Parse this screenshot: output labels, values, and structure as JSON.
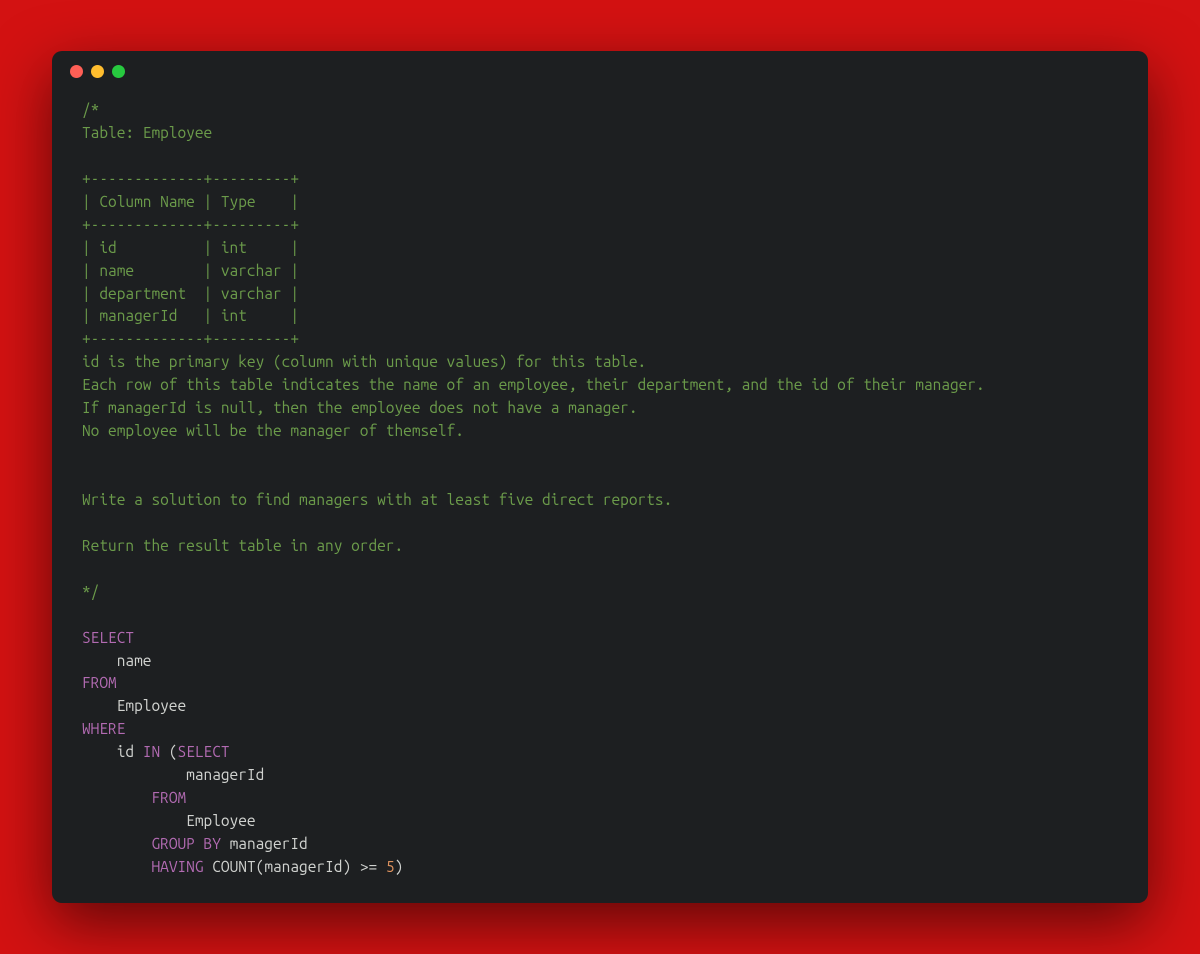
{
  "window": {
    "traffic_lights": [
      "close",
      "minimize",
      "zoom"
    ]
  },
  "code": {
    "tokens": [
      {
        "t": "comment",
        "v": "/*"
      },
      {
        "t": "br"
      },
      {
        "t": "comment",
        "v": "Table: Employee"
      },
      {
        "t": "br"
      },
      {
        "t": "br"
      },
      {
        "t": "comment",
        "v": "+-------------+---------+"
      },
      {
        "t": "br"
      },
      {
        "t": "comment",
        "v": "| Column Name | Type    |"
      },
      {
        "t": "br"
      },
      {
        "t": "comment",
        "v": "+-------------+---------+"
      },
      {
        "t": "br"
      },
      {
        "t": "comment",
        "v": "| id          | int     |"
      },
      {
        "t": "br"
      },
      {
        "t": "comment",
        "v": "| name        | varchar |"
      },
      {
        "t": "br"
      },
      {
        "t": "comment",
        "v": "| department  | varchar |"
      },
      {
        "t": "br"
      },
      {
        "t": "comment",
        "v": "| managerId   | int     |"
      },
      {
        "t": "br"
      },
      {
        "t": "comment",
        "v": "+-------------+---------+"
      },
      {
        "t": "br"
      },
      {
        "t": "comment",
        "v": "id is the primary key (column with unique values) for this table."
      },
      {
        "t": "br"
      },
      {
        "t": "comment",
        "v": "Each row of this table indicates the name of an employee, their department, and the id of their manager."
      },
      {
        "t": "br"
      },
      {
        "t": "comment",
        "v": "If managerId is null, then the employee does not have a manager."
      },
      {
        "t": "br"
      },
      {
        "t": "comment",
        "v": "No employee will be the manager of themself."
      },
      {
        "t": "br"
      },
      {
        "t": "br"
      },
      {
        "t": "br"
      },
      {
        "t": "comment",
        "v": "Write a solution to find managers with at least five direct reports."
      },
      {
        "t": "br"
      },
      {
        "t": "br"
      },
      {
        "t": "comment",
        "v": "Return the result table in any order."
      },
      {
        "t": "br"
      },
      {
        "t": "br"
      },
      {
        "t": "comment",
        "v": "*/"
      },
      {
        "t": "br"
      },
      {
        "t": "br"
      },
      {
        "t": "keyword",
        "v": "SELECT"
      },
      {
        "t": "br"
      },
      {
        "t": "ident",
        "v": "    name"
      },
      {
        "t": "br"
      },
      {
        "t": "keyword",
        "v": "FROM"
      },
      {
        "t": "br"
      },
      {
        "t": "ident",
        "v": "    Employee"
      },
      {
        "t": "br"
      },
      {
        "t": "keyword",
        "v": "WHERE"
      },
      {
        "t": "br"
      },
      {
        "t": "ident",
        "v": "    id "
      },
      {
        "t": "keyword",
        "v": "IN"
      },
      {
        "t": "punct",
        "v": " ("
      },
      {
        "t": "keyword",
        "v": "SELECT"
      },
      {
        "t": "br"
      },
      {
        "t": "ident",
        "v": "            managerId"
      },
      {
        "t": "br"
      },
      {
        "t": "ident",
        "v": "        "
      },
      {
        "t": "keyword",
        "v": "FROM"
      },
      {
        "t": "br"
      },
      {
        "t": "ident",
        "v": "            Employee"
      },
      {
        "t": "br"
      },
      {
        "t": "ident",
        "v": "        "
      },
      {
        "t": "keyword",
        "v": "GROUP BY"
      },
      {
        "t": "ident",
        "v": " managerId"
      },
      {
        "t": "br"
      },
      {
        "t": "ident",
        "v": "        "
      },
      {
        "t": "keyword",
        "v": "HAVING"
      },
      {
        "t": "ident",
        "v": " "
      },
      {
        "t": "func",
        "v": "COUNT"
      },
      {
        "t": "punct",
        "v": "(managerId) "
      },
      {
        "t": "punct",
        "v": ">= "
      },
      {
        "t": "number",
        "v": "5"
      },
      {
        "t": "punct",
        "v": ")"
      }
    ]
  }
}
